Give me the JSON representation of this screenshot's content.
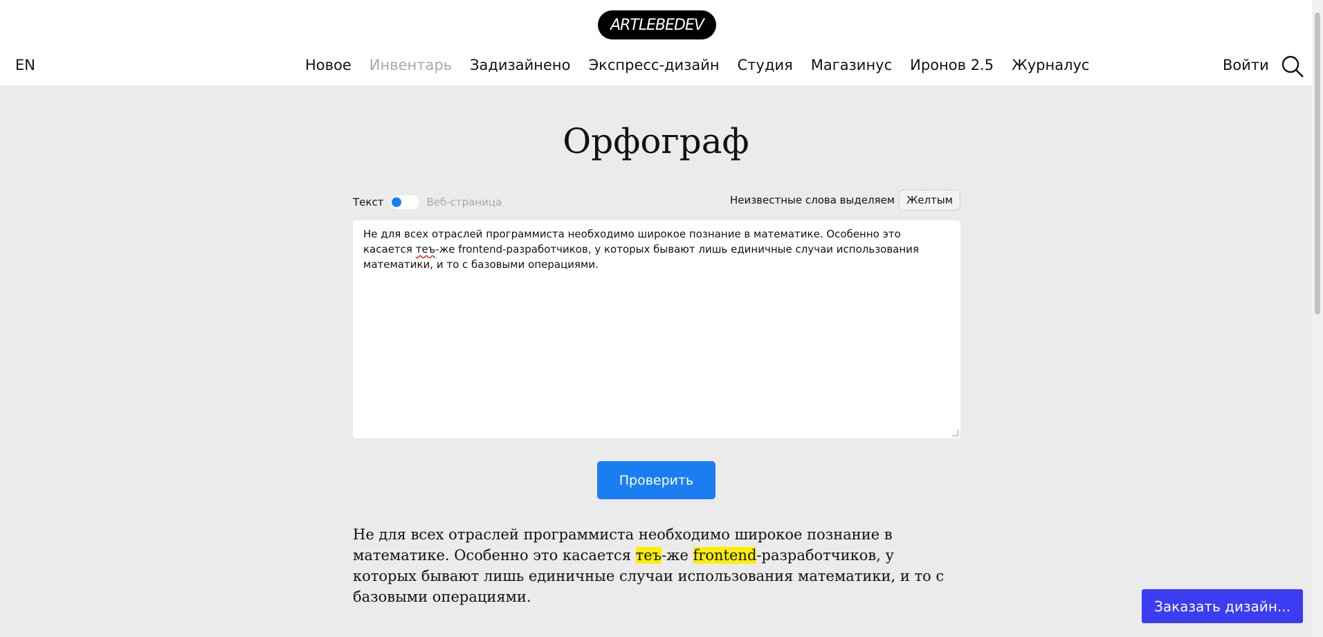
{
  "header": {
    "logo_text": "ARTLEBEDEV",
    "lang": "EN",
    "nav": [
      {
        "label": "Новое"
      },
      {
        "label": "Инвентарь"
      },
      {
        "label": "Задизайнено"
      },
      {
        "label": "Экспресс-дизайн"
      },
      {
        "label": "Студия"
      },
      {
        "label": "Магазинус"
      },
      {
        "label": "Иронов 2.5"
      },
      {
        "label": "Журналус"
      }
    ],
    "login": "Войти",
    "search_icon": "search-icon"
  },
  "main": {
    "title": "Орфограф",
    "mode": {
      "text_label": "Текст",
      "web_label": "Веб-страница"
    },
    "highlight": {
      "label": "Неизвестные слова выделяем",
      "color": "Желтым"
    },
    "input_text": {
      "part1": "Не для всех отраслей программиста необходимо широкое познание в математике. Особенно это касается ",
      "misspelled": "теъ",
      "part2": "-же frontend-разработчиков, у которых бывают лишь единичные случаи использования математики, и то с базовыми операциями."
    },
    "check_button": "Проверить",
    "result": {
      "part1": "Не для всех отраслей программиста необходимо широкое познание в математике. Особенно это касается ",
      "mark1": "теъ",
      "part2": "-же ",
      "mark2": "frontend",
      "part3": "-разработчиков, у которых бывают лишь единичные случаи использования математики, и то с базовыми операциями."
    }
  },
  "order_button": "Заказать дизайн...",
  "colors": {
    "accent": "#1a7ef2",
    "highlight": "#ffee00",
    "order": "#3c3cf2"
  }
}
